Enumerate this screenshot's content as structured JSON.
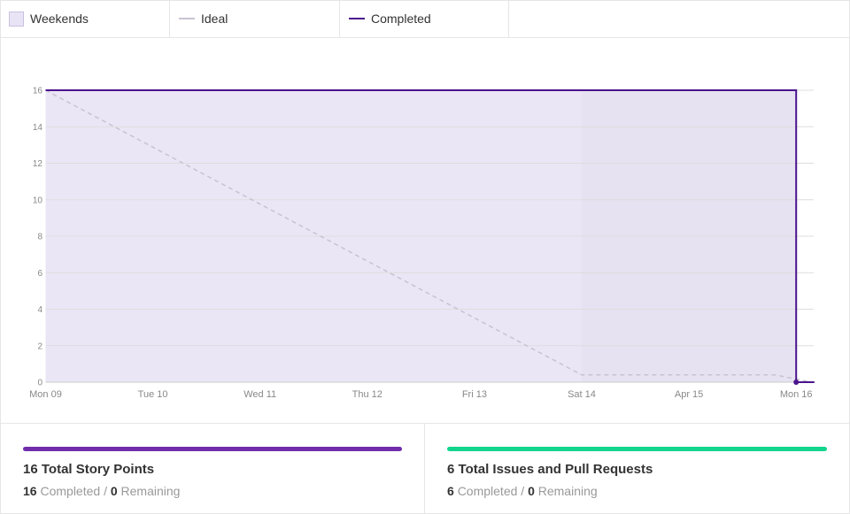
{
  "legend": {
    "weekends_label": "Weekends",
    "ideal_label": "Ideal",
    "completed_label": "Completed"
  },
  "colors": {
    "weekend_fill": "#e6e2f1",
    "area_fill": "#ebe6f6",
    "ideal": "#c8c3d0",
    "completed": "#4a148c",
    "points_bar": "#6f2dab",
    "issues_bar": "#12d48d"
  },
  "chart_data": {
    "type": "line",
    "x": [
      "Mon 09",
      "Tue 10",
      "Wed 11",
      "Thu 12",
      "Fri 13",
      "Sat 14",
      "Apr 15",
      "Mon 16"
    ],
    "ylim": [
      0,
      16
    ],
    "yticks": [
      "0",
      "2",
      "4",
      "6",
      "8",
      "10",
      "12",
      "14",
      "16"
    ],
    "weekend_range": [
      "Sat 14",
      "Mon 16"
    ],
    "series": [
      {
        "name": "Ideal",
        "style": "dashed",
        "points": [
          [
            0,
            16
          ],
          [
            5,
            0.4
          ],
          [
            6.8,
            0.4
          ],
          [
            7.15,
            0
          ]
        ]
      },
      {
        "name": "Completed",
        "style": "solid",
        "points": [
          [
            0,
            16
          ],
          [
            7,
            16
          ],
          [
            7,
            0
          ],
          [
            7.17,
            0
          ]
        ]
      }
    ],
    "grid": true
  },
  "stats": {
    "points": {
      "total": "16",
      "title_text": "Total Story Points",
      "completed": "16",
      "completed_label": "Completed",
      "separator": "/",
      "remaining": "0",
      "remaining_label": "Remaining"
    },
    "issues": {
      "total": "6",
      "title_text": "Total Issues and Pull Requests",
      "completed": "6",
      "completed_label": "Completed",
      "separator": "/",
      "remaining": "0",
      "remaining_label": "Remaining"
    }
  }
}
